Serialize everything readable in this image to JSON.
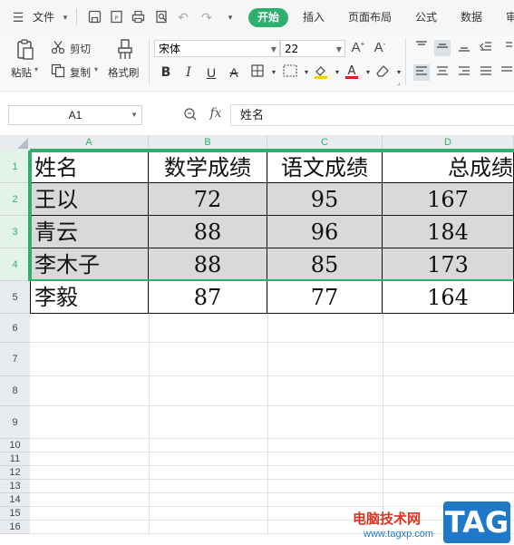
{
  "menubar": {
    "file_label": "文件",
    "tabs": [
      "开始",
      "插入",
      "页面布局",
      "公式",
      "数据",
      "审"
    ]
  },
  "ribbon": {
    "paste_label": "粘贴",
    "cut_label": "剪切",
    "copy_label": "复制",
    "format_painter_label": "格式刷",
    "font_name": "宋体",
    "font_size": "22"
  },
  "formula_bar": {
    "cell_ref": "A1",
    "fx_label": "fx",
    "content": "姓名"
  },
  "sheet": {
    "columns": [
      "A",
      "B",
      "C",
      "D"
    ],
    "row_numbers": [
      "1",
      "2",
      "3",
      "4",
      "5",
      "6",
      "7",
      "8",
      "9",
      "10",
      "11",
      "12",
      "13",
      "14",
      "15",
      "16"
    ],
    "rows": [
      [
        "姓名",
        "数学成绩",
        "语文成绩",
        "总成绩"
      ],
      [
        "王以",
        "72",
        "95",
        "167"
      ],
      [
        "青云",
        "88",
        "96",
        "184"
      ],
      [
        "李木子",
        "88",
        "85",
        "173"
      ],
      [
        "李毅",
        "87",
        "77",
        "164"
      ]
    ]
  },
  "watermark": {
    "site_name": "电脑技术网",
    "url": "www.tagxp.com",
    "tag": "TAG"
  },
  "colors": {
    "accent": "#2cb06b",
    "selection_fill": "#d9d9d9",
    "tag_blue": "#1f78c8"
  }
}
